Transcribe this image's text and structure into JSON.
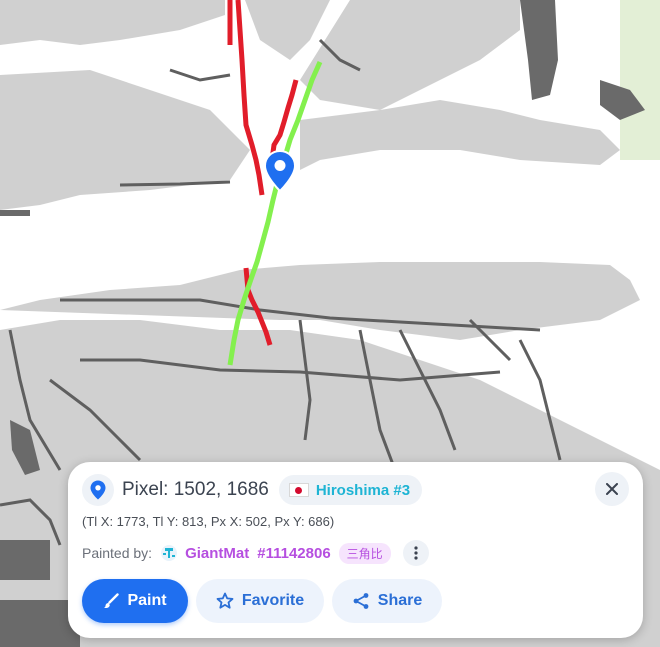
{
  "map": {
    "marker_icon": "map-pin-icon",
    "colors": {
      "road_gray": "#d0d0d0",
      "dark_gray": "#6a6a6a",
      "red_path": "#e11d2a",
      "green_path": "#84f04e",
      "park_green": "#e3efd6"
    }
  },
  "panel": {
    "location_icon": "location-pin-icon",
    "pixel_label": "Pixel: 1502, 1686",
    "region": {
      "flag": "japan-flag-icon",
      "name": "Hiroshima #3"
    },
    "close_icon": "close-icon",
    "coords_text": "(Tl X: 1773, Tl Y: 813, Px X: 502, Px Y: 686)",
    "painted_by_label": "Painted by:",
    "painter": {
      "name": "GiantMat",
      "id": "#11142806",
      "tag": "三角比",
      "icon": "user-avatar-icon"
    },
    "more_icon": "more-vertical-icon",
    "actions": {
      "paint_label": "Paint",
      "favorite_label": "Favorite",
      "share_label": "Share"
    },
    "colors": {
      "primary": "#1f6ff0",
      "region": "#1eb4d4",
      "painter": "#b64fe0"
    }
  }
}
